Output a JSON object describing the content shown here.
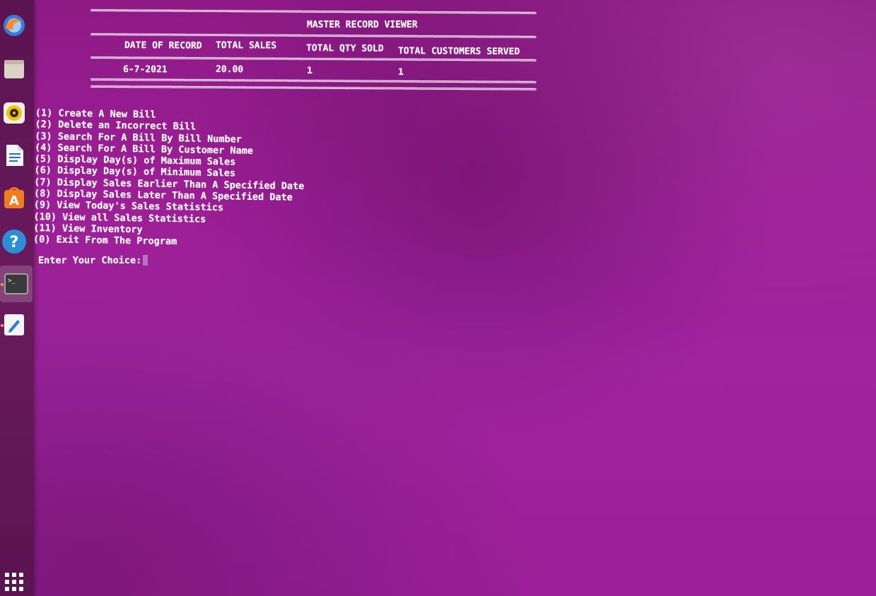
{
  "dock": {
    "items": [
      {
        "icon": "firefox-icon"
      },
      {
        "icon": "files-icon"
      },
      {
        "icon": "rhythmbox-icon"
      },
      {
        "icon": "libreoffice-writer-icon"
      },
      {
        "icon": "software-center-icon"
      },
      {
        "icon": "help-icon"
      },
      {
        "icon": "terminal-icon",
        "active": true
      },
      {
        "icon": "text-editor-icon"
      },
      {
        "icon": "show-applications-icon"
      }
    ]
  },
  "terminal": {
    "rule_text": "=====================================================================================================================================================================",
    "table": {
      "title": "MASTER RECORD VIEWER",
      "headers": [
        "DATE OF RECORD",
        "TOTAL SALES",
        "TOTAL QTY SOLD",
        "TOTAL CUSTOMERS SERVED"
      ],
      "rows": [
        [
          "6-7-2021",
          "20.00",
          "1",
          "1"
        ]
      ]
    },
    "menu": [
      "(1) Create A New Bill",
      "(2) Delete an Incorrect Bill",
      "(3) Search For A Bill By Bill Number",
      "(4) Search For A Bill By Customer Name",
      "(5) Display Day(s) of Maximum Sales",
      "(6) Display Day(s) of Minimum Sales",
      "(7) Display Sales Earlier Than A Specified Date",
      "(8) Display Sales Later Than A Specified Date",
      "(9) View Today's Sales Statistics",
      "(10) View all Sales Statistics",
      "(11) View Inventory",
      "(0) Exit From The Program"
    ],
    "prompt": "Enter Your Choice:"
  },
  "colors": {
    "background": "#9c1f96",
    "text": "#ffffff",
    "dock": "#5a1450"
  }
}
